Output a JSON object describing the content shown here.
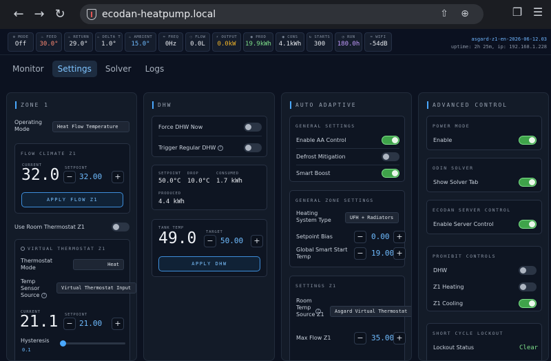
{
  "browser": {
    "url": "ecodan-heatpump.local"
  },
  "status": {
    "tiles": [
      {
        "label": "MODE",
        "value": "Off",
        "color": "#e6e9ee"
      },
      {
        "label": "FEED",
        "value": "30.0°",
        "color": "#ff8a73"
      },
      {
        "label": "RETURN",
        "value": "29.0°",
        "color": "#e6e9ee"
      },
      {
        "label": "DELTA T",
        "value": "1.0°",
        "color": "#e6e9ee"
      },
      {
        "label": "AMBIENT",
        "value": "15.0°",
        "color": "#6fbcff"
      },
      {
        "label": "FREQ",
        "value": "0Hz",
        "color": "#e6e9ee"
      },
      {
        "label": "FLOW",
        "value": "0.0L",
        "color": "#e6e9ee"
      },
      {
        "label": "OUTPUT",
        "value": "0.0kW",
        "color": "#f0b429"
      },
      {
        "label": "PROD",
        "value": "19.9kWh",
        "color": "#7ee08a"
      },
      {
        "label": "CONS",
        "value": "4.1kWh",
        "color": "#e6e9ee"
      },
      {
        "label": "STARTS",
        "value": "300",
        "color": "#e6e9ee"
      },
      {
        "label": "RUN",
        "value": "180.0h",
        "color": "#c39bff"
      },
      {
        "label": "WIFI",
        "value": "-54dB",
        "color": "#e6e9ee"
      }
    ],
    "device": "asgard-z1-en-2026-06-12.03",
    "uptime": "uptime: 2h 25m, ip: 192.168.1.228"
  },
  "tabs": [
    "Monitor",
    "Settings",
    "Solver",
    "Logs"
  ],
  "zone1": {
    "title": "ZONE 1",
    "operating_mode_label": "Operating Mode",
    "operating_mode_value": "Heat Flow Temperature",
    "flow_climate_title": "FLOW CLIMATE Z1",
    "current_label": "CURRENT",
    "current_value": "32.0",
    "setpoint_label": "SETPOINT",
    "setpoint_value": "32.00",
    "apply_flow_label": "APPLY FLOW Z1",
    "use_room_thermostat_label": "Use Room Thermostat Z1",
    "virtual_thermostat_title": "VIRTUAL THERMOSTAT Z1",
    "thermostat_mode_label": "Thermostat Mode",
    "thermostat_mode_value": "Heat",
    "temp_sensor_label": "Temp Sensor Source",
    "temp_sensor_value": "Virtual Thermostat Input",
    "vt_current_value": "21.1",
    "vt_setpoint_value": "21.00",
    "hysteresis_label": "Hysteresis",
    "hysteresis_value": "0.1"
  },
  "dhw": {
    "title": "DHW",
    "force_label": "Force DHW Now",
    "trigger_label": "Trigger Regular DHW",
    "setpoint_label": "SETPOINT",
    "setpoint_value": "50.0°C",
    "drop_label": "DROP",
    "drop_value": "10.0°C",
    "consumed_label": "CONSUMED",
    "consumed_value": "1.7 kWh",
    "produced_label": "PRODUCED",
    "produced_value": "4.4 kWh",
    "tank_temp_label": "TANK TEMP",
    "tank_temp_value": "49.0",
    "target_label": "TARGET",
    "target_value": "50.00",
    "apply_label": "APPLY DHW"
  },
  "auto": {
    "title": "AUTO ADAPTIVE",
    "general_title": "GENERAL SETTINGS",
    "enable_aa_label": "Enable AA Control",
    "defrost_label": "Defrost Mitigation",
    "smart_boost_label": "Smart Boost",
    "zone_settings_title": "GENERAL ZONE SETTINGS",
    "heating_type_label": "Heating System Type",
    "heating_type_value": "UFH + Radiators",
    "setpoint_bias_label": "Setpoint Bias",
    "setpoint_bias_value": "0.00",
    "smart_start_label": "Global Smart Start Temp",
    "smart_start_value": "19.00",
    "settings_z1_title": "SETTINGS Z1",
    "room_temp_label": "Room Temp Source Z1",
    "room_temp_value": "Asgard Virtual Thermostat",
    "max_flow_label": "Max Flow Z1",
    "max_flow_value": "35.00"
  },
  "advanced": {
    "title": "ADVANCED CONTROL",
    "power_title": "POWER MODE",
    "enable_label": "Enable",
    "solver_title": "ODIN SOLVER",
    "show_solver_label": "Show Solver Tab",
    "server_title": "ECODAN SERVER CONTROL",
    "enable_server_label": "Enable Server Control",
    "prohibit_title": "PROHIBIT CONTROLS",
    "dhw_label": "DHW",
    "z1_heating_label": "Z1 Heating",
    "z1_cooling_label": "Z1 Cooling",
    "lockout_title": "SHORT CYCLE LOCKOUT",
    "lockout_status_label": "Lockout Status",
    "lockout_status_value": "Clear"
  }
}
